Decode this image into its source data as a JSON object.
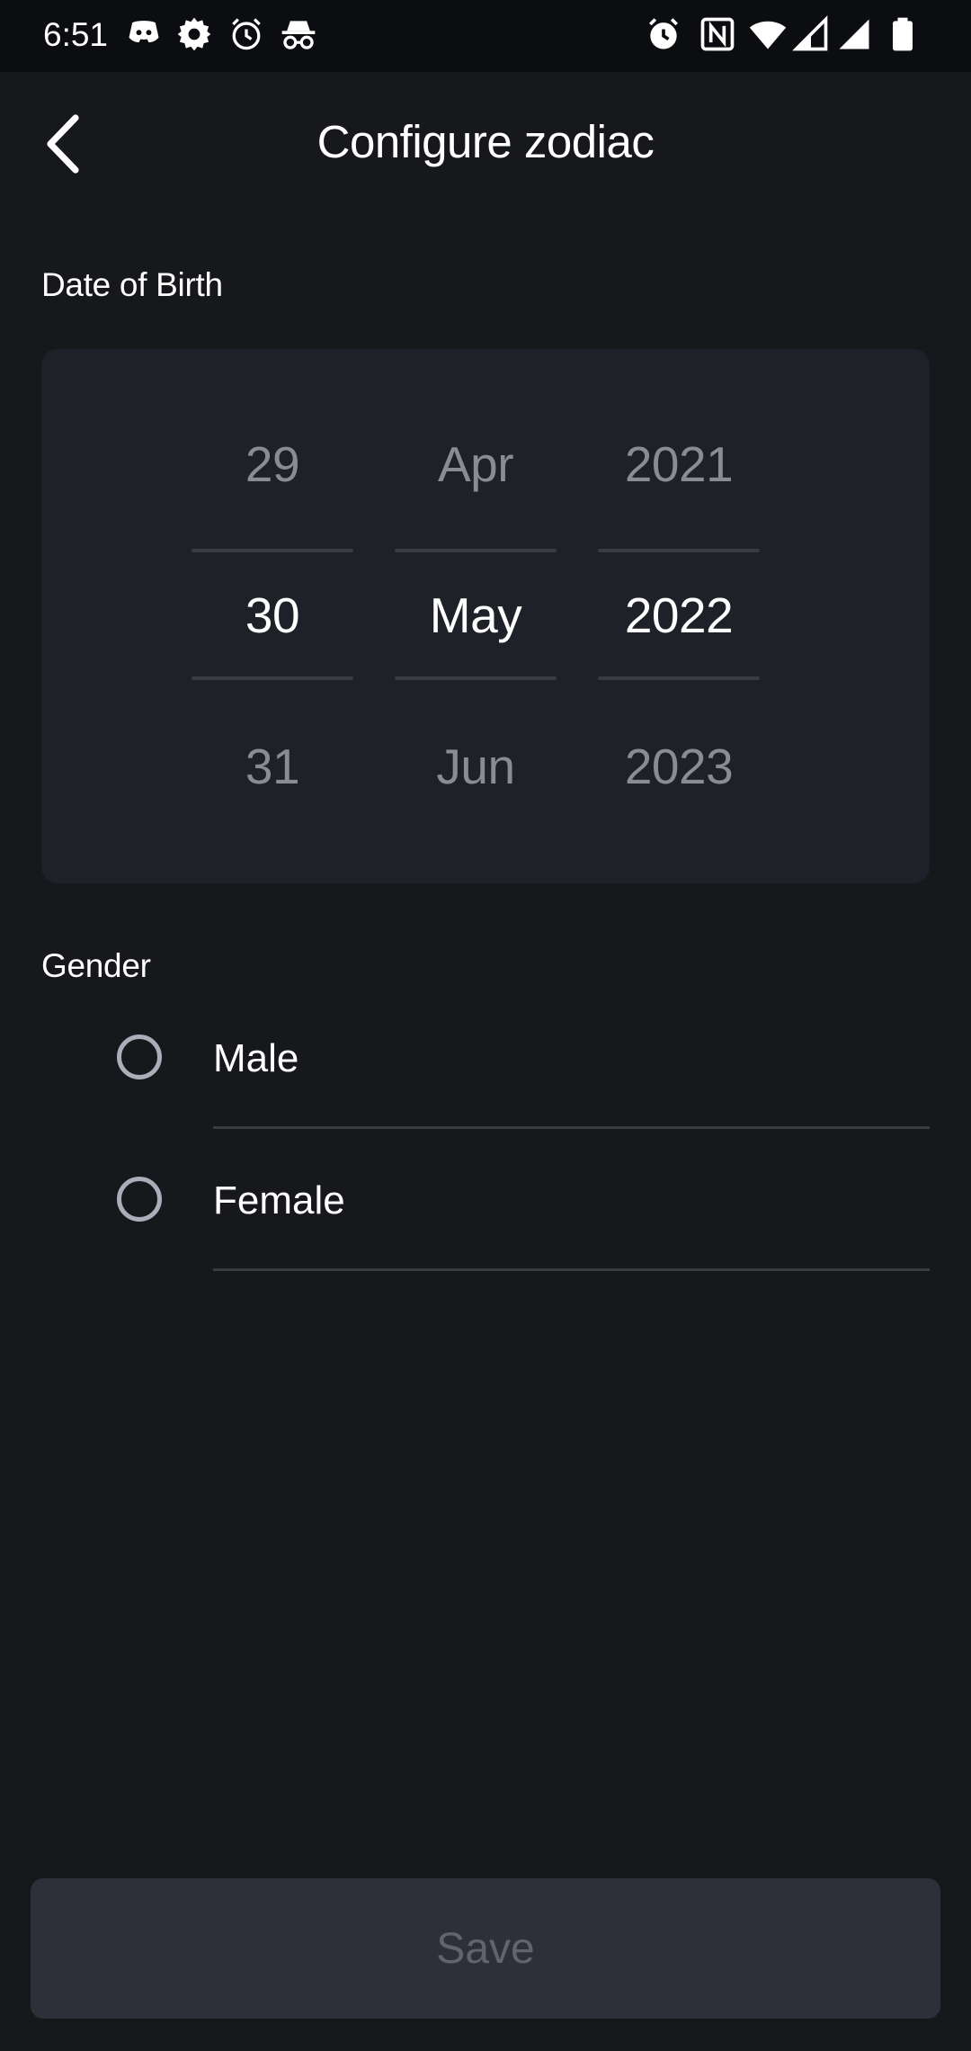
{
  "status_bar": {
    "time": "6:51",
    "left_icons": [
      "discord-icon",
      "settings-icon",
      "alarm-outline-icon",
      "incognito-icon"
    ],
    "right_icons": [
      "alarm-icon",
      "nfc-icon",
      "wifi-icon",
      "signal-icon",
      "signal-full-icon",
      "battery-icon"
    ]
  },
  "header": {
    "title": "Configure zodiac",
    "back_icon": "chevron-left-icon"
  },
  "dob": {
    "label": "Date of Birth",
    "day": {
      "prev": "29",
      "selected": "30",
      "next": "31"
    },
    "month": {
      "prev": "Apr",
      "selected": "May",
      "next": "Jun"
    },
    "year": {
      "prev": "2021",
      "selected": "2022",
      "next": "2023"
    }
  },
  "gender": {
    "label": "Gender",
    "options": [
      {
        "label": "Male",
        "selected": false
      },
      {
        "label": "Female",
        "selected": false
      }
    ]
  },
  "save_button": {
    "label": "Save",
    "enabled": false
  },
  "colors": {
    "background": "#17181c",
    "picker_bg": "#1f2129",
    "button_bg": "#2d3039",
    "button_text_disabled": "#61646c"
  }
}
